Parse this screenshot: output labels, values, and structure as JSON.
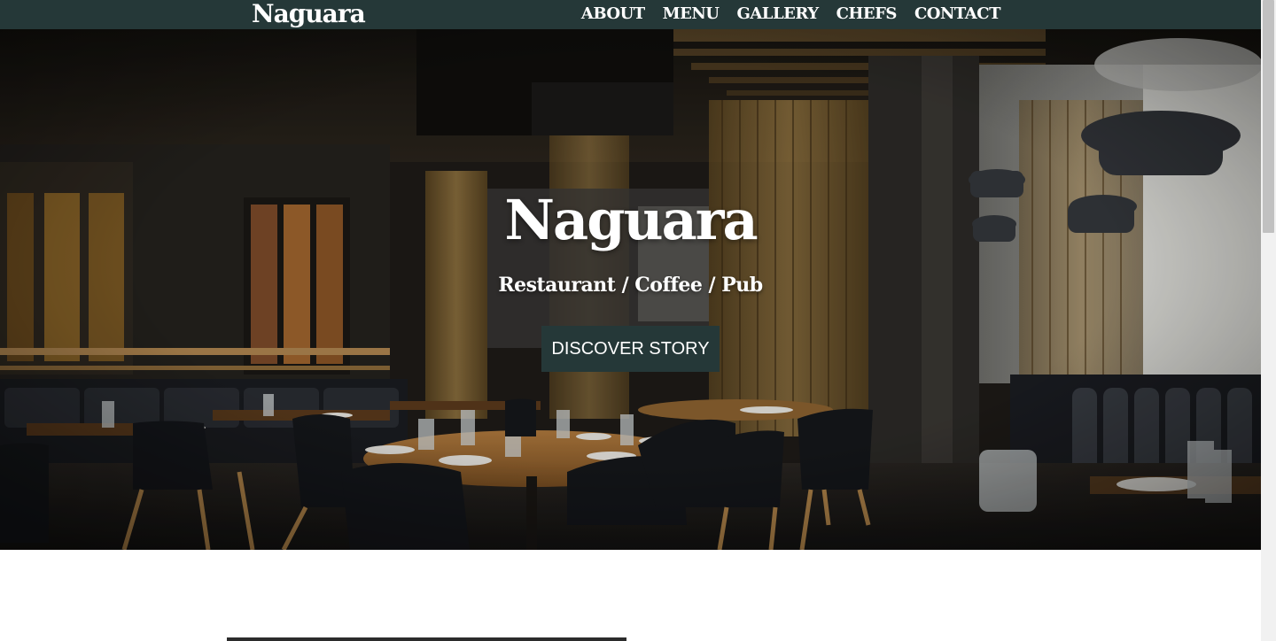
{
  "navbar": {
    "brand": "Naguara",
    "links": [
      {
        "label": "ABOUT"
      },
      {
        "label": "MENU"
      },
      {
        "label": "GALLERY"
      },
      {
        "label": "CHEFS"
      },
      {
        "label": "CONTACT"
      }
    ]
  },
  "hero": {
    "title": "Naguara",
    "subtitle": "Restaurant / Coffee / Pub",
    "cta_label": "DISCOVER STORY"
  },
  "colors": {
    "nav_background": "#253838",
    "button_background": "#253838",
    "text": "#ffffff"
  },
  "icons": {
    "hero_image": "restaurant-interior-photo"
  }
}
